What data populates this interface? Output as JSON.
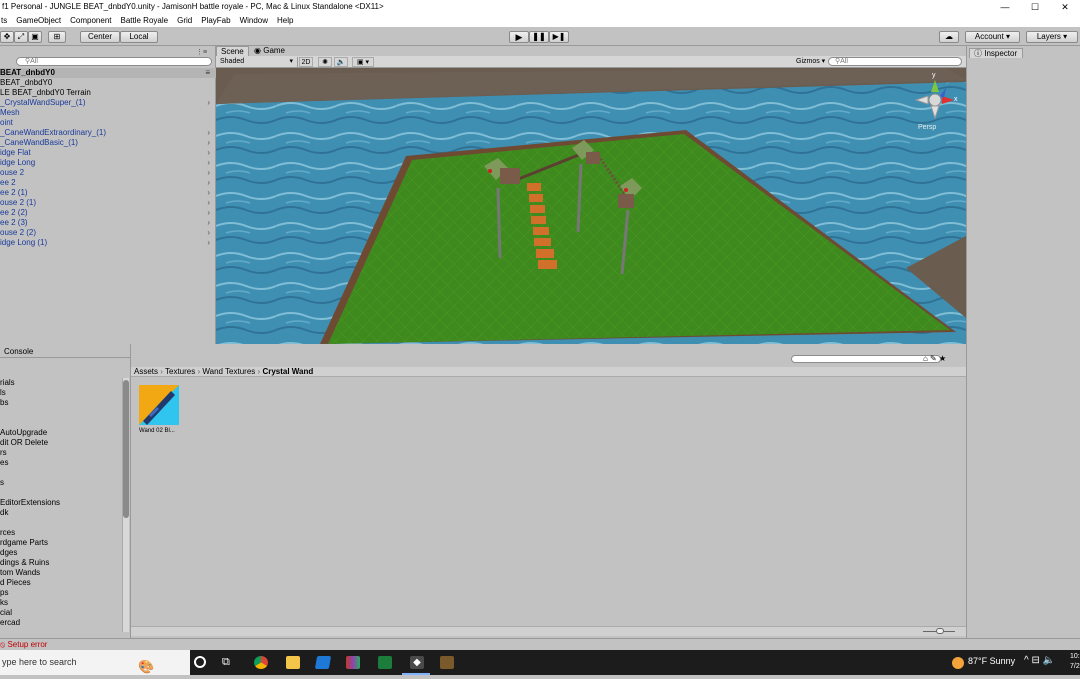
{
  "window": {
    "title": "f1 Personal - JUNGLE BEAT_dnbdY0.unity - JamisonH battle royale - PC, Mac & Linux Standalone <DX11>",
    "minimize": "—",
    "maximize": "☐",
    "close": "✕"
  },
  "menu": [
    "ts",
    "GameObject",
    "Component",
    "Battle Royale",
    "Grid",
    "PlayFab",
    "Window",
    "Help"
  ],
  "toolbar": {
    "center": "Center",
    "local": "Local",
    "account": "Account",
    "layers": "Layers"
  },
  "hierarchy": {
    "search_placeholder": "All",
    "scene": "BEAT_dnbdY0",
    "items": [
      {
        "label": "BEAT_dnbdY0",
        "style": "blk",
        "arrow": false
      },
      {
        "label": "LE BEAT_dnbdY0 Terrain",
        "style": "blk",
        "arrow": false
      },
      {
        "label": "_CrystalWandSuper_(1)",
        "style": "blue",
        "arrow": true
      },
      {
        "label": "Mesh",
        "style": "blue",
        "arrow": false
      },
      {
        "label": "oint",
        "style": "blue",
        "arrow": false
      },
      {
        "label": "_CaneWandExtraordinary_(1)",
        "style": "blue",
        "arrow": true
      },
      {
        "label": "_CaneWandBasic_(1)",
        "style": "blue",
        "arrow": true
      },
      {
        "label": "idge Flat",
        "style": "blue",
        "arrow": true
      },
      {
        "label": "idge Long",
        "style": "blue",
        "arrow": true
      },
      {
        "label": "ouse 2",
        "style": "blue",
        "arrow": true
      },
      {
        "label": "ee 2",
        "style": "blue",
        "arrow": true
      },
      {
        "label": "ee 2 (1)",
        "style": "blue",
        "arrow": true
      },
      {
        "label": "ouse 2 (1)",
        "style": "blue",
        "arrow": true
      },
      {
        "label": "ee 2 (2)",
        "style": "blue",
        "arrow": true
      },
      {
        "label": "ee 2 (3)",
        "style": "blue",
        "arrow": true
      },
      {
        "label": "ouse 2 (2)",
        "style": "blue",
        "arrow": true
      },
      {
        "label": "idge Long (1)",
        "style": "blue",
        "arrow": true
      }
    ]
  },
  "scene_view": {
    "tab_scene": "Scene",
    "tab_game": "Game",
    "shading": "Shaded",
    "mode_2d": "2D",
    "gizmos": "Gizmos",
    "search_placeholder": "All",
    "persp": "Persp",
    "axis_y": "y",
    "axis_x": "x"
  },
  "inspector": {
    "tab": "Inspector"
  },
  "console": {
    "tab": "Console",
    "folders": [
      "rials",
      "ls",
      "bs",
      "",
      "",
      "AutoUpgrade",
      "dit OR Delete",
      "rs",
      "es",
      "",
      "s",
      "",
      "EditorExtensions",
      "dk",
      "",
      "rces",
      "rdgame Parts",
      "dges",
      "dings & Ruins",
      "tom Wands",
      "d Pieces",
      "ps",
      "ks",
      "cial",
      "ercad"
    ]
  },
  "project": {
    "breadcrumb": [
      "Assets",
      "Textures",
      "Wand Textures",
      "Crystal Wand"
    ],
    "asset_label": "Wand 02 Bl..."
  },
  "status": {
    "message": "Setup error"
  },
  "taskbar": {
    "search_placeholder": "ype here to search",
    "weather": "87°F  Sunny",
    "time": "10:",
    "date": "7/2"
  },
  "colors": {
    "water": "#3f8fb3",
    "grass": "#3f8a1e",
    "unity_gray": "#c2c2c2"
  }
}
